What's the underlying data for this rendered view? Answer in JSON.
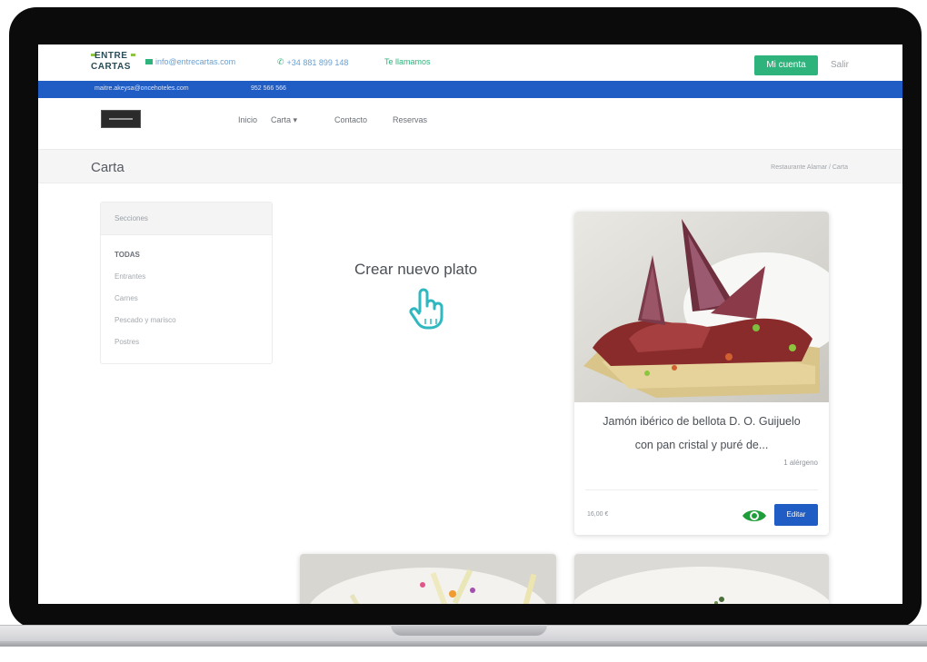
{
  "brand": {
    "logo_line1": "ENTRE",
    "logo_line2": "CARTAS"
  },
  "topbar": {
    "email": "info@entrecartas.com",
    "phone": "+34 881 899 148",
    "callback": "Te llamamos",
    "account_button": "Mi cuenta",
    "logout": "Salir"
  },
  "bluebar": {
    "email": "maitre.akeysa@oncehoteles.com",
    "phone": "952 566 566"
  },
  "nav": {
    "items": [
      {
        "label": "Inicio"
      },
      {
        "label": "Carta ▾"
      },
      {
        "label": "Contacto"
      },
      {
        "label": "Reservas"
      }
    ]
  },
  "page": {
    "title": "Carta",
    "breadcrumb": "Restaurante Alamar / Carta"
  },
  "sidebar": {
    "heading": "Secciones",
    "items": [
      {
        "label": "TODAS"
      },
      {
        "label": "Entrantes"
      },
      {
        "label": "Carnes"
      },
      {
        "label": "Pescado y marisco"
      },
      {
        "label": "Postres"
      }
    ]
  },
  "create": {
    "label": "Crear nuevo plato"
  },
  "dish": {
    "name_line1": "Jamón ibérico de bellota D. O. Guijuelo",
    "name_line2": "con pan cristal y puré de...",
    "allergens": "1 alérgeno",
    "price": "16,00 €",
    "edit_button": "Editar"
  },
  "colors": {
    "green": "#2db37b",
    "blue": "#1f5cc4",
    "text": "#4a4f55"
  }
}
